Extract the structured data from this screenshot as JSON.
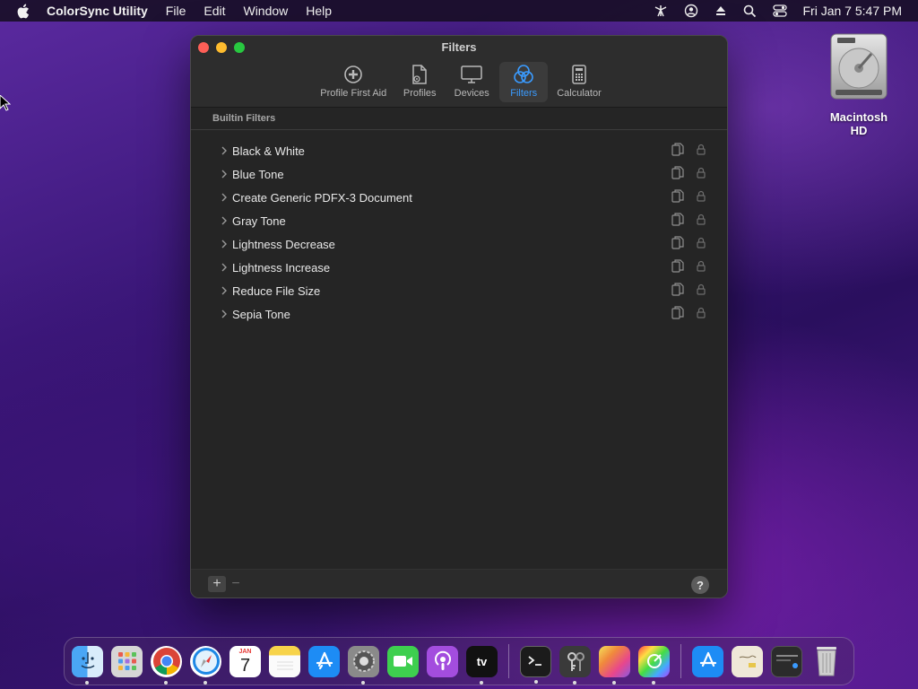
{
  "menubar": {
    "app_name": "ColorSync Utility",
    "menus": [
      "File",
      "Edit",
      "Window",
      "Help"
    ],
    "clock": "Fri Jan 7  5:47 PM"
  },
  "window": {
    "title": "Filters",
    "toolbar": [
      {
        "label": "Profile First Aid",
        "icon": "plus-circle-icon"
      },
      {
        "label": "Profiles",
        "icon": "profile-doc-icon"
      },
      {
        "label": "Devices",
        "icon": "display-icon"
      },
      {
        "label": "Filters",
        "icon": "color-circles-icon",
        "active": true
      },
      {
        "label": "Calculator",
        "icon": "calculator-icon"
      }
    ],
    "section_header": "Builtin Filters",
    "filters": [
      "Black & White",
      "Blue Tone",
      "Create Generic PDFX-3 Document",
      "Gray Tone",
      "Lightness Decrease",
      "Lightness Increase",
      "Reduce File Size",
      "Sepia Tone"
    ],
    "add_label": "+",
    "remove_label": "−",
    "help_label": "?"
  },
  "desktop": {
    "disk_label": "Macintosh HD"
  },
  "dock": {
    "calendar_month": "JAN",
    "calendar_day": "7",
    "tv_label": "tv"
  },
  "colors": {
    "accent": "#3a9bff",
    "close": "#fe5f57",
    "minimize": "#febc2e",
    "maximize": "#28c840"
  }
}
